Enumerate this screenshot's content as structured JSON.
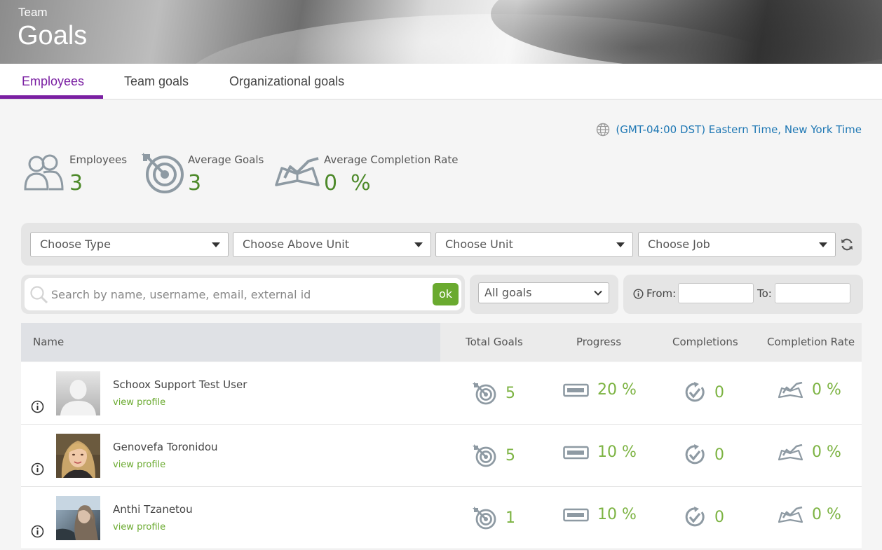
{
  "header": {
    "subtitle": "Team",
    "title": "Goals"
  },
  "tabs": [
    {
      "label": "Employees",
      "active": true
    },
    {
      "label": "Team goals",
      "active": false
    },
    {
      "label": "Organizational goals",
      "active": false
    }
  ],
  "timezone": {
    "icon": "globe-icon",
    "text": "(GMT-04:00 DST) Eastern Time, New York Time"
  },
  "stats": {
    "employees": {
      "label": "Employees",
      "value": "3",
      "icon": "users-icon"
    },
    "average_goals": {
      "label": "Average Goals",
      "value": "3",
      "icon": "target-icon"
    },
    "average_completion_rate": {
      "label": "Average Completion Rate",
      "value": "0  %",
      "icon": "book-check-icon"
    }
  },
  "filters": {
    "type": "Choose Type",
    "above_unit": "Choose Above Unit",
    "unit": "Choose Unit",
    "job": "Choose Job",
    "refresh_icon": "refresh-icon"
  },
  "search": {
    "placeholder": "Search by name, username, email, external id",
    "value": "",
    "ok_label": "ok"
  },
  "goals_filter": {
    "selected": "All goals"
  },
  "date_range": {
    "from_label": "From:",
    "to_label": "To:",
    "from_value": "",
    "to_value": ""
  },
  "table": {
    "headers": {
      "name": "Name",
      "total_goals": "Total Goals",
      "progress": "Progress",
      "completions": "Completions",
      "completion_rate": "Completion Rate"
    },
    "rows": [
      {
        "name": "Schoox Support Test User",
        "link": "view profile",
        "total_goals": "5",
        "progress": "20 %",
        "completions": "0",
        "completion_rate": "0 %"
      },
      {
        "name": "Genovefa Toronidou",
        "link": "view profile",
        "total_goals": "5",
        "progress": "10 %",
        "completions": "0",
        "completion_rate": "0 %"
      },
      {
        "name": "Anthi Tzanetou",
        "link": "view profile",
        "total_goals": "1",
        "progress": "10 %",
        "completions": "0",
        "completion_rate": "0 %"
      }
    ]
  },
  "colors": {
    "accent_purple": "#7a1fa2",
    "value_green": "#7cb342",
    "link_blue": "#1f78b4",
    "ok_green": "#6aaa2f"
  }
}
